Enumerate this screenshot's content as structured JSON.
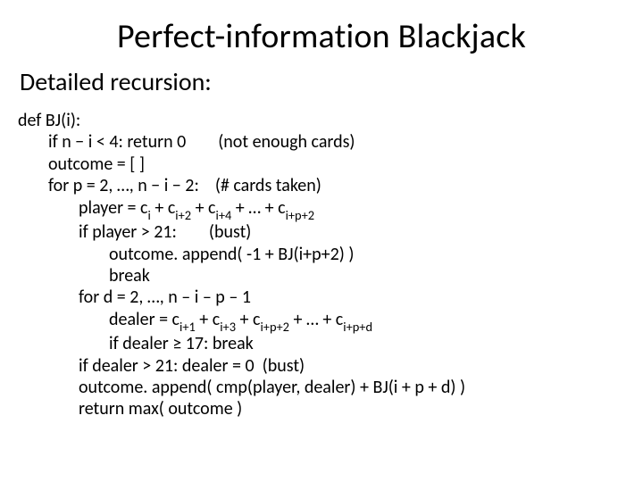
{
  "title": "Perfect-information Blackjack",
  "subtitle": "Detailed recursion:",
  "code": {
    "l0": "def BJ(i):",
    "l1a": "if n − i < 4: return 0",
    "l1b": "(not enough cards)",
    "l2": "outcome = [  ]",
    "l3a": "for p = 2, …, n − i − 2:",
    "l3b": "(# cards taken)",
    "l4_pre": "player = c",
    "l4_s1": "i",
    "l4_a": " + c",
    "l4_s2": "i+2",
    "l4_b": " + c",
    "l4_s3": "i+4",
    "l4_c": " + … + c",
    "l4_s4": "i+p+2",
    "l5a": "if player > 21:",
    "l5b": "(bust)",
    "l6": "outcome. append(  -1  + BJ(i+p+2) )",
    "l7": "break",
    "l8": "for d = 2, …, n – i – p – 1",
    "l9_pre": "dealer = c",
    "l9_s1": "i+1",
    "l9_a": " + c",
    "l9_s2": "i+3",
    "l9_b": " + c",
    "l9_s3": "i+p+2",
    "l9_c": " + … + c",
    "l9_s4": "i+p+d",
    "l10": "if dealer ≥ 17: break",
    "l11a": "if dealer > 21: dealer = 0",
    "l11b": "(bust)",
    "l12": "outcome. append(  cmp(player, dealer) + BJ(i + p + d) )",
    "l13": "return max( outcome )"
  }
}
